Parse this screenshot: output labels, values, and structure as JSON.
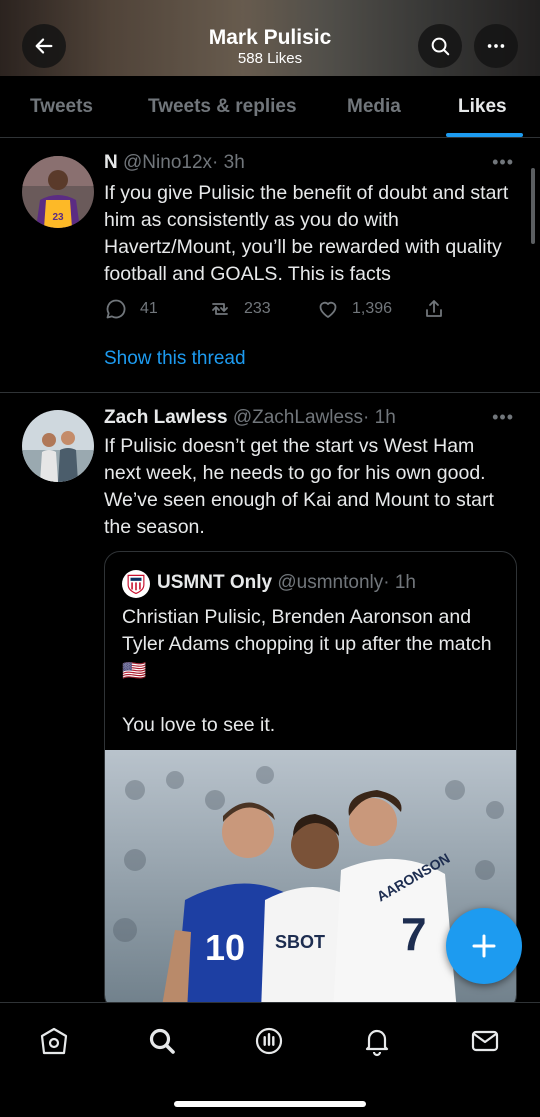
{
  "header": {
    "title": "Mark Pulisic",
    "subtitle": "588 Likes",
    "back_icon": "arrow-left-icon",
    "search_icon": "search-icon",
    "more_icon": "more-horizontal-icon"
  },
  "tabs": [
    {
      "label": "Tweets",
      "active": false
    },
    {
      "label": "Tweets & replies",
      "active": false
    },
    {
      "label": "Media",
      "active": false
    },
    {
      "label": "Likes",
      "active": true
    }
  ],
  "tweets": [
    {
      "display_name": "N",
      "handle": "@Nino12x",
      "time": "· 3h",
      "text": "If you give Pulisic the benefit of doubt and start him as consistently as you do with Havertz/Mount, you’ll be rewarded with quality football and GOALS. This is facts",
      "replies": "41",
      "retweets": "233",
      "likes": "1,396",
      "thread_link": "Show this thread"
    },
    {
      "display_name": "Zach Lawless",
      "handle": "@ZachLawless",
      "time": "· 1h",
      "text": "If Pulisic doesn’t get the start vs West Ham next week, he needs to go for his own good. We’ve seen enough of Kai and Mount to start the season.",
      "quote": {
        "display_name": "USMNT Only",
        "handle": "@usmntonly",
        "time": "· 1h",
        "text": "Christian Pulisic, Brenden Aaronson and Tyler Adams chopping it up after the match 🇺🇸\n\nYou love to see it.",
        "image_text": {
          "shirt_number_left": "10",
          "shirt_number_right": "7",
          "shirt_name": "AARONSON",
          "sponsor": "SBOT"
        }
      }
    }
  ],
  "nav": [
    "home-icon",
    "search-icon",
    "spaces-icon",
    "notifications-icon",
    "messages-icon"
  ],
  "colors": {
    "accent": "#1d9bf0",
    "background": "#000000",
    "muted": "#71767b"
  }
}
